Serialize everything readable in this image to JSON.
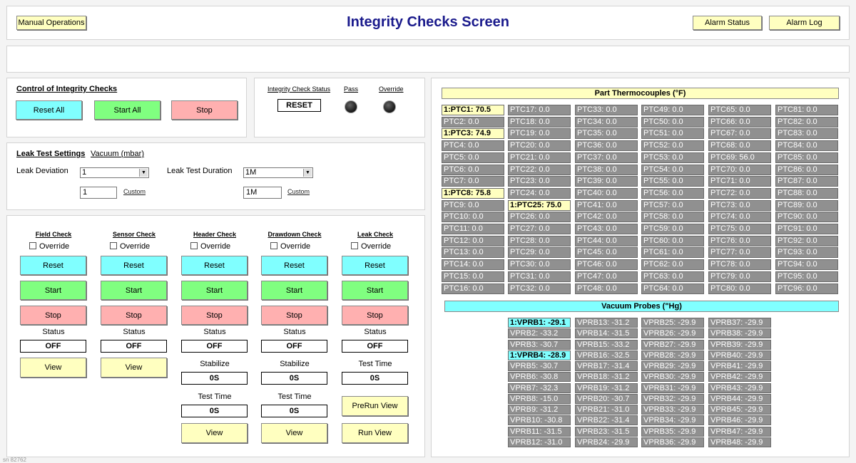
{
  "header": {
    "title": "Integrity Checks Screen",
    "manual_ops": "Manual Operations",
    "alarm_status": "Alarm Status",
    "alarm_log": "Alarm Log"
  },
  "control": {
    "title": "Control of Integrity Checks",
    "reset_all": "Reset All",
    "start_all": "Start All",
    "stop": "Stop"
  },
  "status_panel": {
    "label": "Integrity Check Status",
    "pass": "Pass",
    "override": "Override",
    "value": "RESET"
  },
  "leak_settings": {
    "title": "Leak Test Settings",
    "units": "Vacuum (mbar)",
    "deviation_label": "Leak Deviation",
    "deviation_value": "1",
    "deviation_input": "1",
    "duration_label": "Leak Test Duration",
    "duration_value": "1M",
    "duration_input": "1M",
    "custom": "Custom"
  },
  "checks": [
    {
      "title": "Field Check",
      "override": "Override",
      "reset": "Reset",
      "start": "Start",
      "stop": "Stop",
      "status_label": "Status",
      "status": "OFF",
      "view": "View"
    },
    {
      "title": "Sensor Check",
      "override": "Override",
      "reset": "Reset",
      "start": "Start",
      "stop": "Stop",
      "status_label": "Status",
      "status": "OFF",
      "view": "View"
    },
    {
      "title": "Header Check",
      "override": "Override",
      "reset": "Reset",
      "start": "Start",
      "stop": "Stop",
      "status_label": "Status",
      "status": "OFF",
      "stabilize_label": "Stabilize",
      "stabilize": "0S",
      "testtime_label": "Test Time",
      "testtime": "0S",
      "view": "View"
    },
    {
      "title": "Drawdown Check",
      "override": "Override",
      "reset": "Reset",
      "start": "Start",
      "stop": "Stop",
      "status_label": "Status",
      "status": "OFF",
      "stabilize_label": "Stabilize",
      "stabilize": "0S",
      "testtime_label": "Test Time",
      "testtime": "0S",
      "view": "View"
    },
    {
      "title": "Leak Check",
      "override": "Override",
      "reset": "Reset",
      "start": "Start",
      "stop": "Stop",
      "status_label": "Status",
      "status": "OFF",
      "testtime_label": "Test Time",
      "testtime": "0S",
      "prerun": "PreRun View",
      "run": "Run View"
    }
  ],
  "thermocouples": {
    "title": "Part Thermocouples (°F)",
    "columns": [
      [
        "1:PTC1: 70.5",
        "PTC2: 0.0",
        "1:PTC3: 74.9",
        "PTC4: 0.0",
        "PTC5: 0.0",
        "PTC6: 0.0",
        "PTC7: 0.0",
        "1:PTC8: 75.8",
        "PTC9: 0.0",
        "PTC10: 0.0",
        "PTC11: 0.0",
        "PTC12: 0.0",
        "PTC13: 0.0",
        "PTC14: 0.0",
        "PTC15: 0.0",
        "PTC16: 0.0"
      ],
      [
        "PTC17: 0.0",
        "PTC18: 0.0",
        "PTC19: 0.0",
        "PTC20: 0.0",
        "PTC21: 0.0",
        "PTC22: 0.0",
        "PTC23: 0.0",
        "PTC24: 0.0",
        "1:PTC25: 75.0",
        "PTC26: 0.0",
        "PTC27: 0.0",
        "PTC28: 0.0",
        "PTC29: 0.0",
        "PTC30: 0.0",
        "PTC31: 0.0",
        "PTC32: 0.0"
      ],
      [
        "PTC33: 0.0",
        "PTC34: 0.0",
        "PTC35: 0.0",
        "PTC36: 0.0",
        "PTC37: 0.0",
        "PTC38: 0.0",
        "PTC39: 0.0",
        "PTC40: 0.0",
        "PTC41: 0.0",
        "PTC42: 0.0",
        "PTC43: 0.0",
        "PTC44: 0.0",
        "PTC45: 0.0",
        "PTC46: 0.0",
        "PTC47: 0.0",
        "PTC48: 0.0"
      ],
      [
        "PTC49: 0.0",
        "PTC50: 0.0",
        "PTC51: 0.0",
        "PTC52: 0.0",
        "PTC53: 0.0",
        "PTC54: 0.0",
        "PTC55: 0.0",
        "PTC56: 0.0",
        "PTC57: 0.0",
        "PTC58: 0.0",
        "PTC59: 0.0",
        "PTC60: 0.0",
        "PTC61: 0.0",
        "PTC62: 0.0",
        "PTC63: 0.0",
        "PTC64: 0.0"
      ],
      [
        "PTC65: 0.0",
        "PTC66: 0.0",
        "PTC67: 0.0",
        "PTC68: 0.0",
        "PTC69: 56.0",
        "PTC70: 0.0",
        "PTC71: 0.0",
        "PTC72: 0.0",
        "PTC73: 0.0",
        "PTC74: 0.0",
        "PTC75: 0.0",
        "PTC76: 0.0",
        "PTC77: 0.0",
        "PTC78: 0.0",
        "PTC79: 0.0",
        "PTC80: 0.0"
      ],
      [
        "PTC81: 0.0",
        "PTC82: 0.0",
        "PTC83: 0.0",
        "PTC84: 0.0",
        "PTC85: 0.0",
        "PTC86: 0.0",
        "PTC87: 0.0",
        "PTC88: 0.0",
        "PTC89: 0.0",
        "PTC90: 0.0",
        "PTC91: 0.0",
        "PTC92: 0.0",
        "PTC93: 0.0",
        "PTC94: 0.0",
        "PTC95: 0.0",
        "PTC96: 0.0"
      ]
    ],
    "highlighted": [
      "1:PTC1: 70.5",
      "1:PTC3: 74.9",
      "1:PTC8: 75.8",
      "1:PTC25: 75.0"
    ]
  },
  "vacuum": {
    "title": "Vacuum Probes (\"Hg)",
    "columns": [
      [
        "1:VPRB1: -29.1",
        "VPRB2: -33.2",
        "VPRB3: -30.7",
        "1:VPRB4: -28.9",
        "VPRB5: -30.7",
        "VPRB6: -30.8",
        "VPRB7: -32.3",
        "VPRB8: -15.0",
        "VPRB9: -31.2",
        "VPRB10: -30.8",
        "VPRB11: -31.5",
        "VPRB12: -31.0"
      ],
      [
        "VPRB13: -31.2",
        "VPRB14: -31.5",
        "VPRB15: -33.2",
        "VPRB16: -32.5",
        "VPRB17: -31.4",
        "VPRB18: -31.2",
        "VPRB19: -31.2",
        "VPRB20: -30.7",
        "VPRB21: -31.0",
        "VPRB22: -31.4",
        "VPRB23: -31.5",
        "VPRB24: -29.9"
      ],
      [
        "VPRB25: -29.9",
        "VPRB26: -29.9",
        "VPRB27: -29.9",
        "VPRB28: -29.9",
        "VPRB29: -29.9",
        "VPRB30: -29.9",
        "VPRB31: -29.9",
        "VPRB32: -29.9",
        "VPRB33: -29.9",
        "VPRB34: -29.9",
        "VPRB35: -29.9",
        "VPRB36: -29.9"
      ],
      [
        "VPRB37: -29.9",
        "VPRB38: -29.9",
        "VPRB39: -29.9",
        "VPRB40: -29.9",
        "VPRB41: -29.9",
        "VPRB42: -29.9",
        "VPRB43: -29.9",
        "VPRB44: -29.9",
        "VPRB45: -29.9",
        "VPRB46: -29.9",
        "VPRB47: -29.9",
        "VPRB48: -29.9"
      ]
    ],
    "highlighted": [
      "1:VPRB1: -29.1",
      "1:VPRB4: -28.9"
    ]
  },
  "footer": "sn 82762"
}
